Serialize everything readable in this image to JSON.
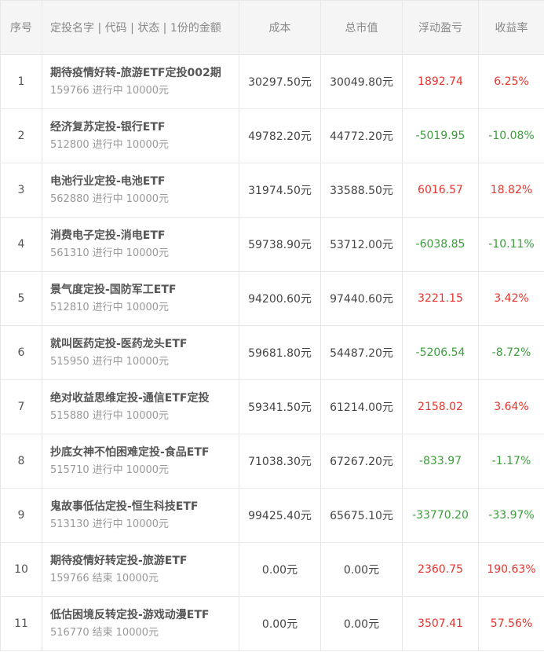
{
  "headers": {
    "index": "序号",
    "name": "定投名字 | 代码 | 状态 | 1份的金额",
    "cost": "成本",
    "value": "总市值",
    "pnl": "浮动盈亏",
    "rate": "收益率"
  },
  "colors": {
    "gain": "#e3342f",
    "loss": "#3c9c3c"
  },
  "rows": [
    {
      "idx": "1",
      "name": "期待疫情好转-旅游ETF定投002期",
      "code": "159766",
      "status": "进行中",
      "amount": "10000元",
      "cost": "30297.50元",
      "value": "30049.80元",
      "pnl": "1892.74",
      "rate": "6.25%",
      "trend": "up"
    },
    {
      "idx": "2",
      "name": "经济复苏定投-银行ETF",
      "code": "512800",
      "status": "进行中",
      "amount": "10000元",
      "cost": "49782.20元",
      "value": "44772.20元",
      "pnl": "-5019.95",
      "rate": "-10.08%",
      "trend": "down"
    },
    {
      "idx": "3",
      "name": "电池行业定投-电池ETF",
      "code": "562880",
      "status": "进行中",
      "amount": "10000元",
      "cost": "31974.50元",
      "value": "33588.50元",
      "pnl": "6016.57",
      "rate": "18.82%",
      "trend": "up"
    },
    {
      "idx": "4",
      "name": "消费电子定投-消电ETF",
      "code": "561310",
      "status": "进行中",
      "amount": "10000元",
      "cost": "59738.90元",
      "value": "53712.00元",
      "pnl": "-6038.85",
      "rate": "-10.11%",
      "trend": "down"
    },
    {
      "idx": "5",
      "name": "景气度定投-国防军工ETF",
      "code": "512810",
      "status": "进行中",
      "amount": "10000元",
      "cost": "94200.60元",
      "value": "97440.60元",
      "pnl": "3221.15",
      "rate": "3.42%",
      "trend": "up"
    },
    {
      "idx": "6",
      "name": "就叫医药定投-医药龙头ETF",
      "code": "515950",
      "status": "进行中",
      "amount": "10000元",
      "cost": "59681.80元",
      "value": "54487.20元",
      "pnl": "-5206.54",
      "rate": "-8.72%",
      "trend": "down"
    },
    {
      "idx": "7",
      "name": "绝对收益思维定投-通信ETF定投",
      "code": "515880",
      "status": "进行中",
      "amount": "10000元",
      "cost": "59341.50元",
      "value": "61214.00元",
      "pnl": "2158.02",
      "rate": "3.64%",
      "trend": "up"
    },
    {
      "idx": "8",
      "name": "抄底女神不怕困难定投-食品ETF",
      "code": "515710",
      "status": "进行中",
      "amount": "10000元",
      "cost": "71038.30元",
      "value": "67267.20元",
      "pnl": "-833.97",
      "rate": "-1.17%",
      "trend": "down"
    },
    {
      "idx": "9",
      "name": "鬼故事低估定投-恒生科技ETF",
      "code": "513130",
      "status": "进行中",
      "amount": "10000元",
      "cost": "99425.40元",
      "value": "65675.10元",
      "pnl": "-33770.20",
      "rate": "-33.97%",
      "trend": "down"
    },
    {
      "idx": "10",
      "name": "期待疫情好转定投-旅游ETF",
      "code": "159766",
      "status": "结束",
      "amount": "10000元",
      "cost": "0.00元",
      "value": "0.00元",
      "pnl": "2360.75",
      "rate": "190.63%",
      "trend": "up"
    },
    {
      "idx": "11",
      "name": "低估困境反转定投-游戏动漫ETF",
      "code": "516770",
      "status": "结束",
      "amount": "10000元",
      "cost": "0.00元",
      "value": "0.00元",
      "pnl": "3507.41",
      "rate": "57.56%",
      "trend": "up"
    }
  ]
}
